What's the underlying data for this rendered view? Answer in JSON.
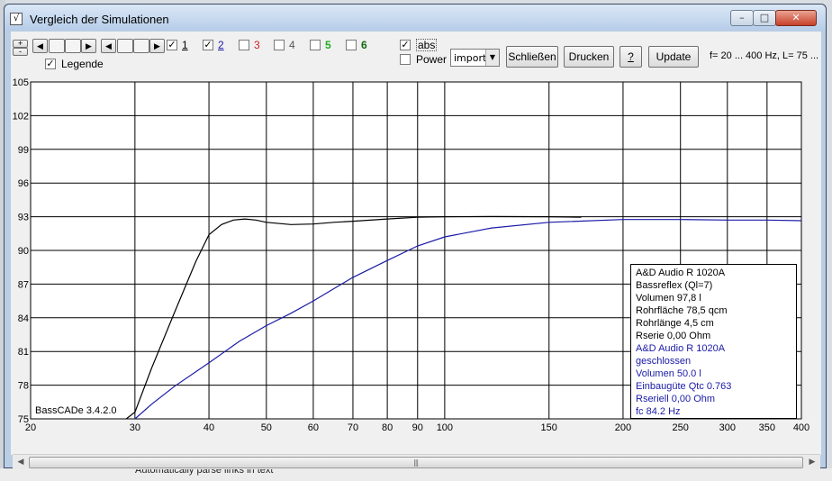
{
  "window": {
    "title": "Vergleich der Simulationen"
  },
  "background": {
    "bottom_text": "Automatically parse links in text"
  },
  "toolbar": {
    "plus_label": "+",
    "minus_label": "-",
    "series_toggles": [
      {
        "label": "1",
        "checked": true,
        "color": "#000000"
      },
      {
        "label": "2",
        "checked": true,
        "color": "#1a1aa8"
      },
      {
        "label": "3",
        "checked": false,
        "color": "#cc2222"
      },
      {
        "label": "4",
        "checked": false,
        "color": "#555555"
      },
      {
        "label": "5",
        "checked": false,
        "color": "#22aa22"
      },
      {
        "label": "6",
        "checked": false,
        "color": "#116611"
      }
    ],
    "abs_label": "abs",
    "abs_checked": true,
    "power_label": "Power",
    "power_checked": false,
    "legende_label": "Legende",
    "legende_checked": true,
    "select_value": "import",
    "close_button": "Schließen",
    "print_button": "Drucken",
    "help_button": "?",
    "update_button": "Update",
    "info_text": "f= 20 ... 400 Hz, L= 75 ..."
  },
  "chart_data": {
    "type": "line",
    "x_scale": "log",
    "xlim": [
      20,
      400
    ],
    "ylim": [
      75,
      105
    ],
    "x_ticks": [
      20,
      30,
      40,
      50,
      60,
      70,
      80,
      90,
      100,
      150,
      200,
      250,
      300,
      350,
      400
    ],
    "y_ticks": [
      75,
      78,
      81,
      84,
      87,
      90,
      93,
      96,
      99,
      102,
      105
    ],
    "grid": true,
    "watermark": "BassCADe 3.4.2.0",
    "series": [
      {
        "color": "#000000",
        "x": [
          29,
          30,
          32,
          35,
          38,
          40,
          42,
          44,
          46,
          48,
          50,
          55,
          60,
          65,
          70,
          80,
          90,
          100,
          120,
          150,
          170
        ],
        "y": [
          75,
          75.6,
          79.5,
          84.5,
          89.0,
          91.4,
          92.3,
          92.7,
          92.8,
          92.7,
          92.5,
          92.3,
          92.35,
          92.5,
          92.6,
          92.8,
          92.95,
          93.0,
          93.02,
          93.0,
          92.95
        ]
      },
      {
        "color": "#1a1aa8",
        "x": [
          30,
          32,
          35,
          40,
          45,
          50,
          55,
          60,
          70,
          80,
          90,
          100,
          120,
          150,
          200,
          250,
          300,
          350,
          400
        ],
        "y": [
          75,
          76.3,
          77.9,
          80.0,
          81.9,
          83.3,
          84.4,
          85.5,
          87.6,
          89.1,
          90.4,
          91.2,
          92.0,
          92.5,
          92.75,
          92.75,
          92.7,
          92.7,
          92.65
        ]
      }
    ],
    "legend_entries": [
      {
        "text": "A&D Audio R 1020A",
        "color": "#000000"
      },
      {
        "text": "Bassreflex (Ql=7)",
        "color": "#000000"
      },
      {
        "text": "Volumen 97,8 l",
        "color": "#000000"
      },
      {
        "text": "Rohrfläche 78,5 qcm",
        "color": "#000000"
      },
      {
        "text": "Rohrlänge 4,5 cm",
        "color": "#000000"
      },
      {
        "text": "Rserie 0,00 Ohm",
        "color": "#000000"
      },
      {
        "text": "A&D Audio R 1020A",
        "color": "#1a1aa8"
      },
      {
        "text": "geschlossen",
        "color": "#1a1aa8"
      },
      {
        "text": "Volumen 50.0 l",
        "color": "#1a1aa8"
      },
      {
        "text": "Einbaugüte Qtc 0.763",
        "color": "#1a1aa8"
      },
      {
        "text": "Rseriell 0,00 Ohm",
        "color": "#1a1aa8"
      },
      {
        "text": "fc 84.2 Hz",
        "color": "#1a1aa8"
      }
    ]
  }
}
